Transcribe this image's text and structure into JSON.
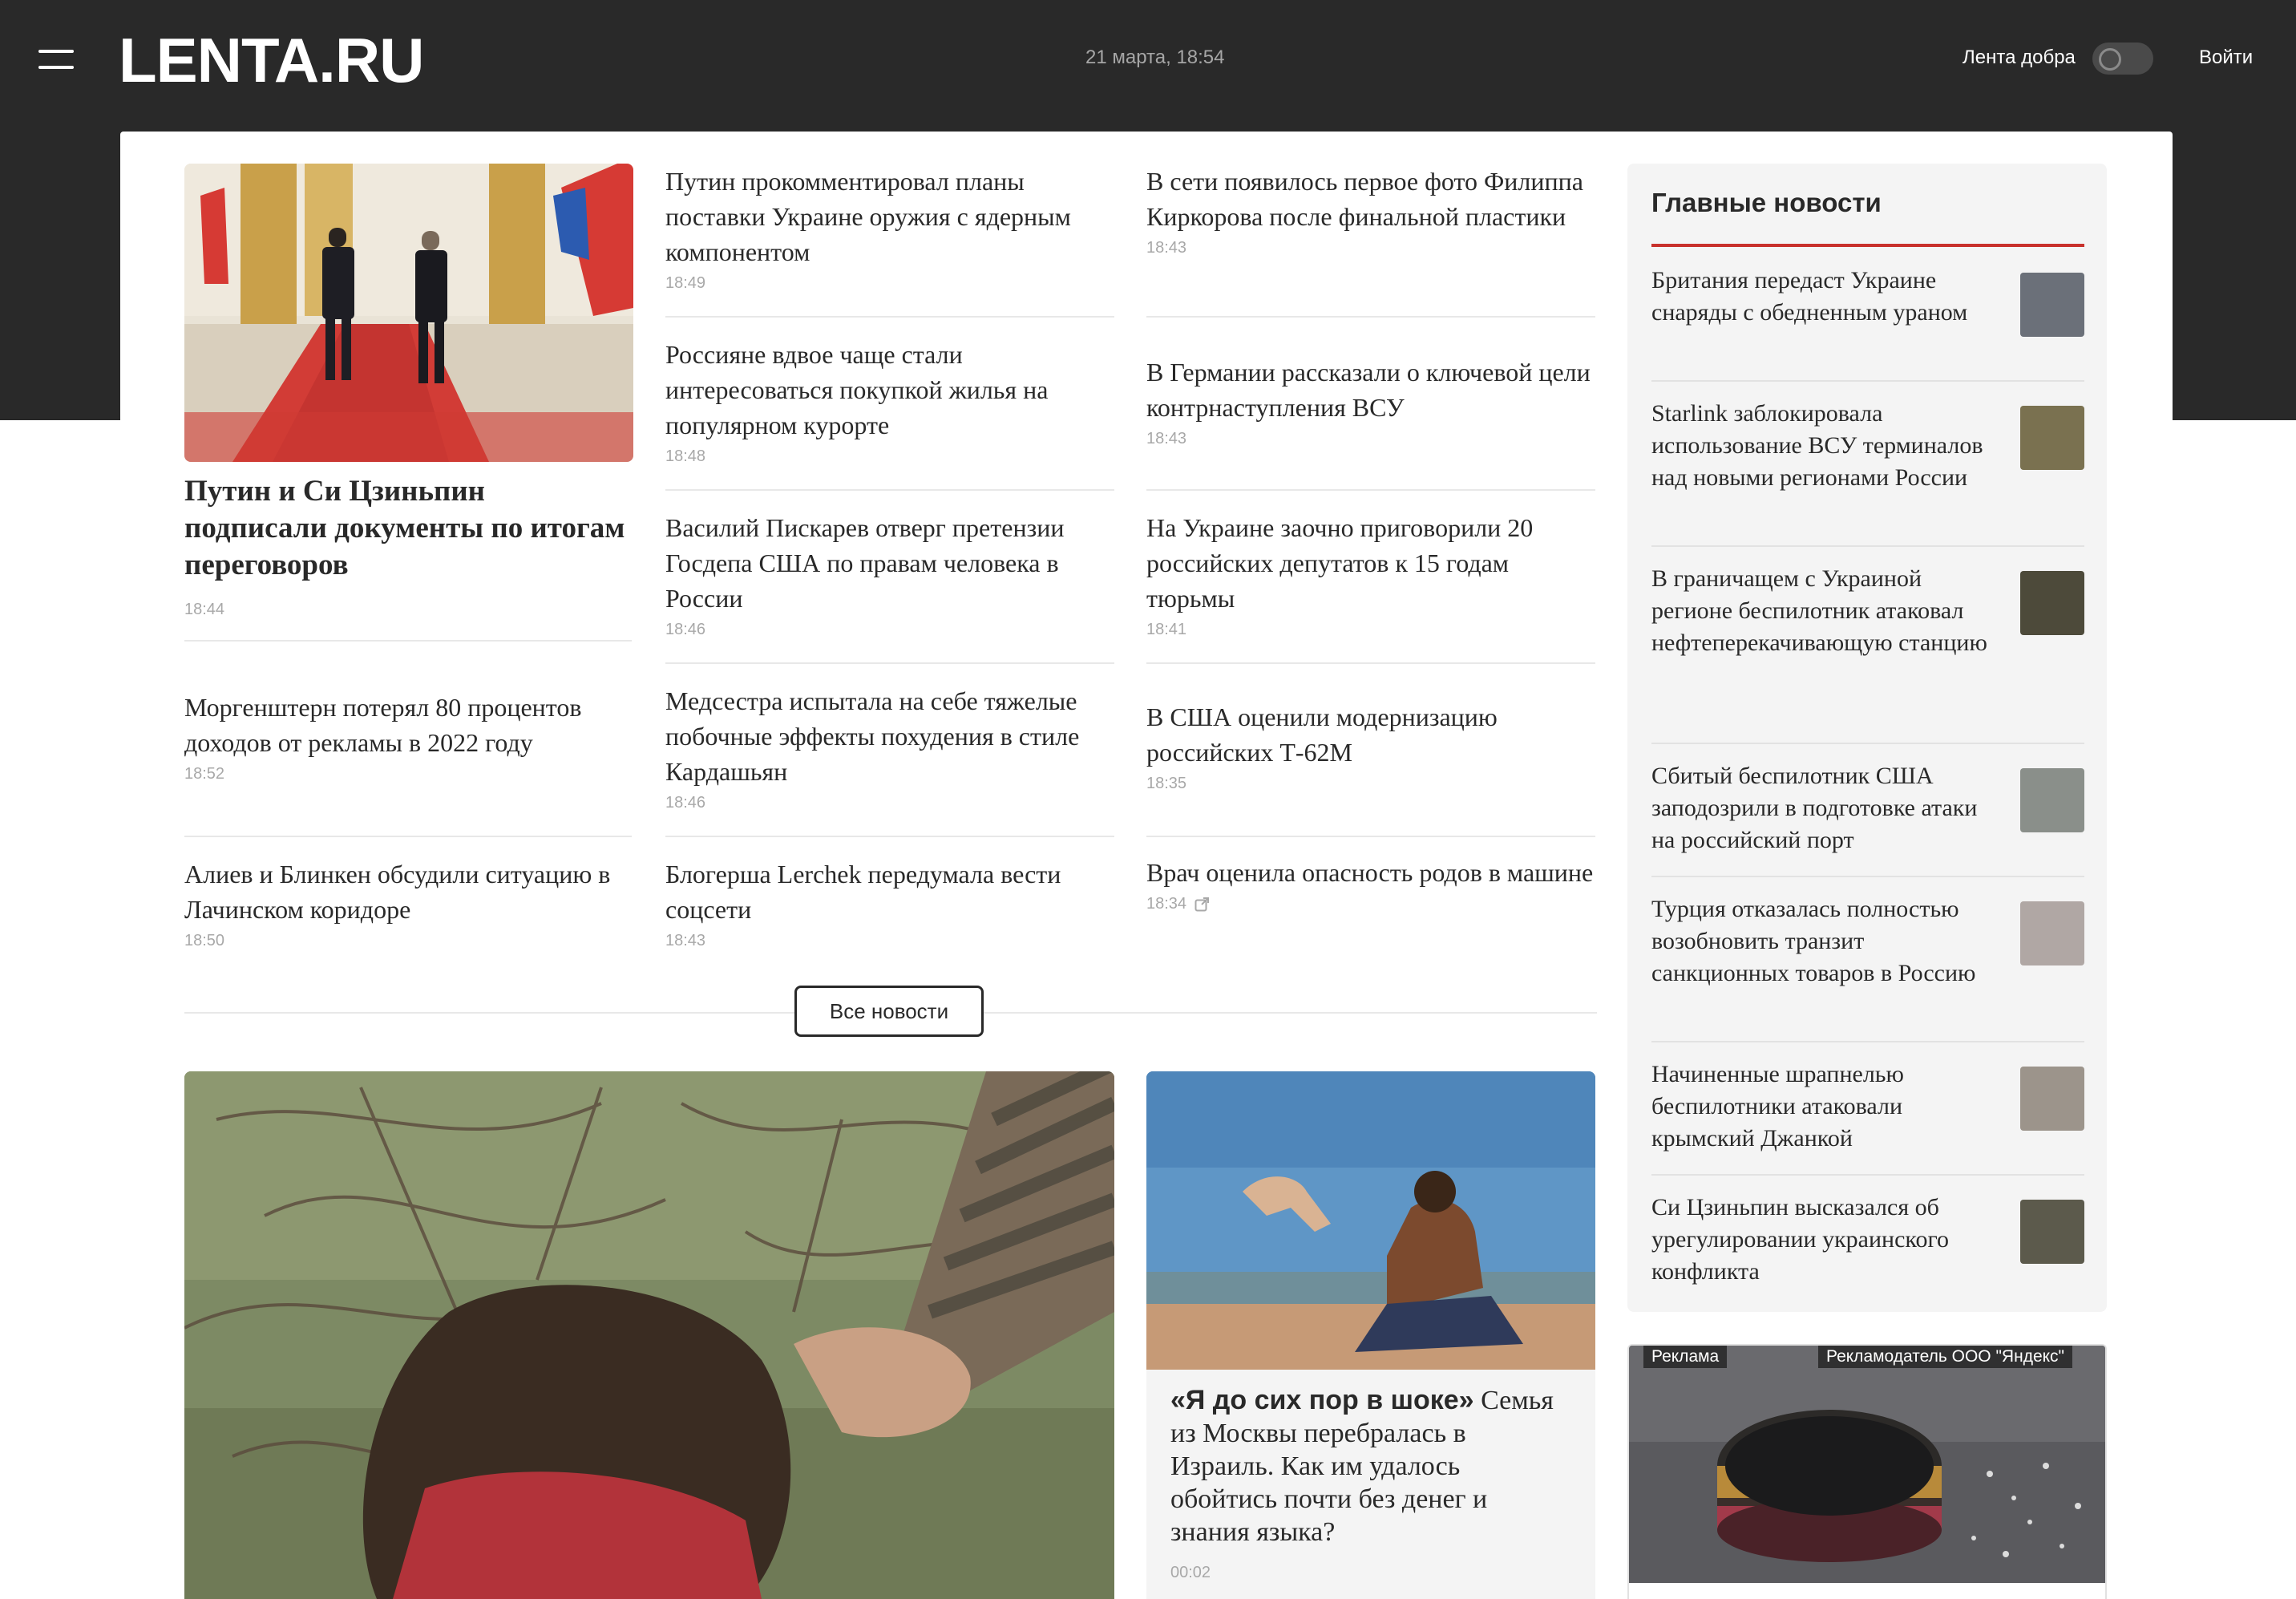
{
  "header": {
    "logo": "LENTA.RU",
    "date": "21 марта, 18:54",
    "kind_news_label": "Лента добра",
    "login_label": "Войти"
  },
  "top_story": {
    "title": "Путин и Си Цзиньпин подписали документы по итогам переговоров",
    "time": "18:44"
  },
  "news_left": [
    {
      "title": "Моргенштерн потерял 80 процентов доходов от рекламы в 2022 году",
      "time": "18:52"
    },
    {
      "title": "Алиев и Блинкен обсудили ситуацию в Лачинском коридоре",
      "time": "18:50"
    }
  ],
  "news_mid": [
    {
      "title": "Путин прокомментировал планы поставки Украине оружия с ядерным компонентом",
      "time": "18:49"
    },
    {
      "title": "Россияне вдвое чаще стали интересоваться покупкой жилья на популярном курорте",
      "time": "18:48"
    },
    {
      "title": "Василий Пискарев отверг претензии Госдепа США по правам человека в России",
      "time": "18:46"
    },
    {
      "title": "Медсестра испытала на себе тяжелые побочные эффекты похудения в стиле Кардашьян",
      "time": "18:46"
    },
    {
      "title": "Блогерша Lerchek передумала вести соцсети",
      "time": "18:43"
    }
  ],
  "news_right": [
    {
      "title": "В сети появилось первое фото Филиппа Киркорова после финальной пластики",
      "time": "18:43"
    },
    {
      "title": "В Германии рассказали о ключевой цели контрнаступления ВСУ",
      "time": "18:43"
    },
    {
      "title": "На Украине заочно приговорили 20 российских депутатов к 15 годам тюрьмы",
      "time": "18:41"
    },
    {
      "title": "В США оценили модернизацию российских Т-62М",
      "time": "18:35"
    },
    {
      "title": "Врач оценила опасность родов в машине",
      "time": "18:34"
    }
  ],
  "all_news_label": "Все новости",
  "feature": {
    "bold": "«Я до сих пор в шоке»",
    "text": " Семья из Москвы перебралась в Израиль. Как им удалось обойтись почти без денег и знания языка?",
    "time": "00:02"
  },
  "sidebar": {
    "title": "Главные новости",
    "items": [
      {
        "text": "Британия передаст Украине снаряды с обедненным ураном",
        "thumb_color": "#6b7079"
      },
      {
        "text": "Starlink заблокировала использование ВСУ терминалов над новыми регионами России",
        "thumb_color": "#7a7150"
      },
      {
        "text": "В граничащем с Украиной регионе беспилотник атаковал нефтеперекачивающую станцию",
        "thumb_color": "#4d4a3a"
      },
      {
        "text": "Сбитый беспилотник США заподозрили в подготовке атаки на российский порт",
        "thumb_color": "#8a8f8a"
      },
      {
        "text": "Турция отказалась полностью возобновить транзит санкционных товаров в Россию",
        "thumb_color": "#b0a7a4"
      },
      {
        "text": "Начиненные шрапнелью беспилотники атаковали крымский Джанкой",
        "thumb_color": "#9c948b"
      },
      {
        "text": "Си Цзиньпин высказался об урегулировании украинского конфликта",
        "thumb_color": "#5c5a4c"
      }
    ]
  },
  "ad": {
    "label": "Реклама",
    "advertiser": "Рекламодатель ООО \"Яндекс\""
  },
  "colors": {
    "header_bg": "#292929",
    "accent_red": "#c8312c",
    "sidebar_bg": "#f4f4f4"
  },
  "icons": [
    "menu-icon",
    "toggle-switch",
    "external-link-icon"
  ]
}
